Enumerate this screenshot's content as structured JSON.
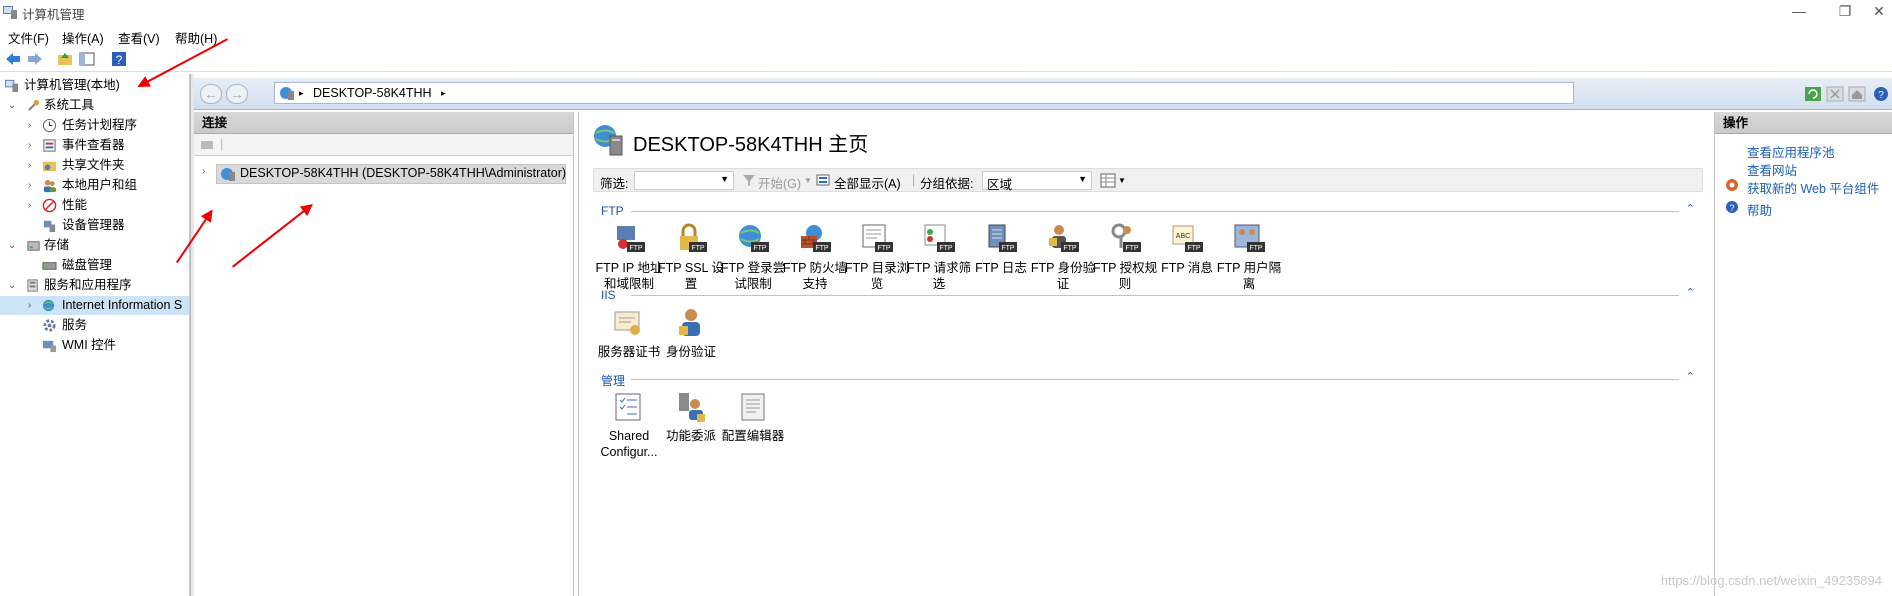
{
  "window": {
    "title": "计算机管理",
    "minimize": "—",
    "restore": "❐",
    "close": "✕"
  },
  "menu": [
    "文件(F)",
    "操作(A)",
    "查看(V)",
    "帮助(H)"
  ],
  "tree": {
    "root": "计算机管理(本地)",
    "items": [
      {
        "label": "系统工具",
        "level": 1,
        "expander": "⌄"
      },
      {
        "label": "任务计划程序",
        "level": 2,
        "expander": "›"
      },
      {
        "label": "事件查看器",
        "level": 2,
        "expander": "›"
      },
      {
        "label": "共享文件夹",
        "level": 2,
        "expander": "›"
      },
      {
        "label": "本地用户和组",
        "level": 2,
        "expander": "›"
      },
      {
        "label": "性能",
        "level": 2,
        "expander": "›"
      },
      {
        "label": "设备管理器",
        "level": 2,
        "expander": ""
      },
      {
        "label": "存储",
        "level": 1,
        "expander": "⌄"
      },
      {
        "label": "磁盘管理",
        "level": 2,
        "expander": ""
      },
      {
        "label": "服务和应用程序",
        "level": 1,
        "expander": "⌄"
      },
      {
        "label": "Internet Information S",
        "level": 2,
        "expander": "›"
      },
      {
        "label": "服务",
        "level": 2,
        "expander": ""
      },
      {
        "label": "WMI 控件",
        "level": 2,
        "expander": ""
      }
    ]
  },
  "address": {
    "segment": "DESKTOP-58K4THH",
    "sep1": "▸",
    "sep2": "▸"
  },
  "connections": {
    "header": "连接",
    "node": "DESKTOP-58K4THH (DESKTOP-58K4THH\\Administrator)"
  },
  "center": {
    "title": "DESKTOP-58K4THH 主页",
    "filter_label": "筛选:",
    "start_label": "开始(G)",
    "show_all_label": "全部显示(A)",
    "group_label": "分组依据:",
    "group_value": "区域"
  },
  "sections": {
    "ftp": {
      "title": "FTP",
      "features": [
        {
          "l1": "FTP IP 地址",
          "l2": "和域限制"
        },
        {
          "l1": "FTP SSL 设",
          "l2": "置"
        },
        {
          "l1": "FTP 登录尝",
          "l2": "试限制"
        },
        {
          "l1": "FTP 防火墙",
          "l2": "支持"
        },
        {
          "l1": "FTP 目录浏",
          "l2": "览"
        },
        {
          "l1": "FTP 请求筛",
          "l2": "选"
        },
        {
          "l1": "FTP 日志",
          "l2": ""
        },
        {
          "l1": "FTP 身份验",
          "l2": "证"
        },
        {
          "l1": "FTP 授权规",
          "l2": "则"
        },
        {
          "l1": "FTP 消息",
          "l2": ""
        },
        {
          "l1": "FTP 用户隔",
          "l2": "离"
        }
      ]
    },
    "iis": {
      "title": "IIS",
      "features": [
        {
          "l1": "服务器证书",
          "l2": ""
        },
        {
          "l1": "身份验证",
          "l2": ""
        }
      ]
    },
    "mgmt": {
      "title": "管理",
      "features": [
        {
          "l1": "Shared",
          "l2": "Configur..."
        },
        {
          "l1": "功能委派",
          "l2": ""
        },
        {
          "l1": "配置编辑器",
          "l2": ""
        }
      ]
    }
  },
  "actions": {
    "header": "操作",
    "links": [
      "查看应用程序池",
      "查看网站",
      "获取新的 Web 平台组件",
      "帮助"
    ]
  },
  "watermark": "https://blog.csdn.net/weixin_49235894"
}
